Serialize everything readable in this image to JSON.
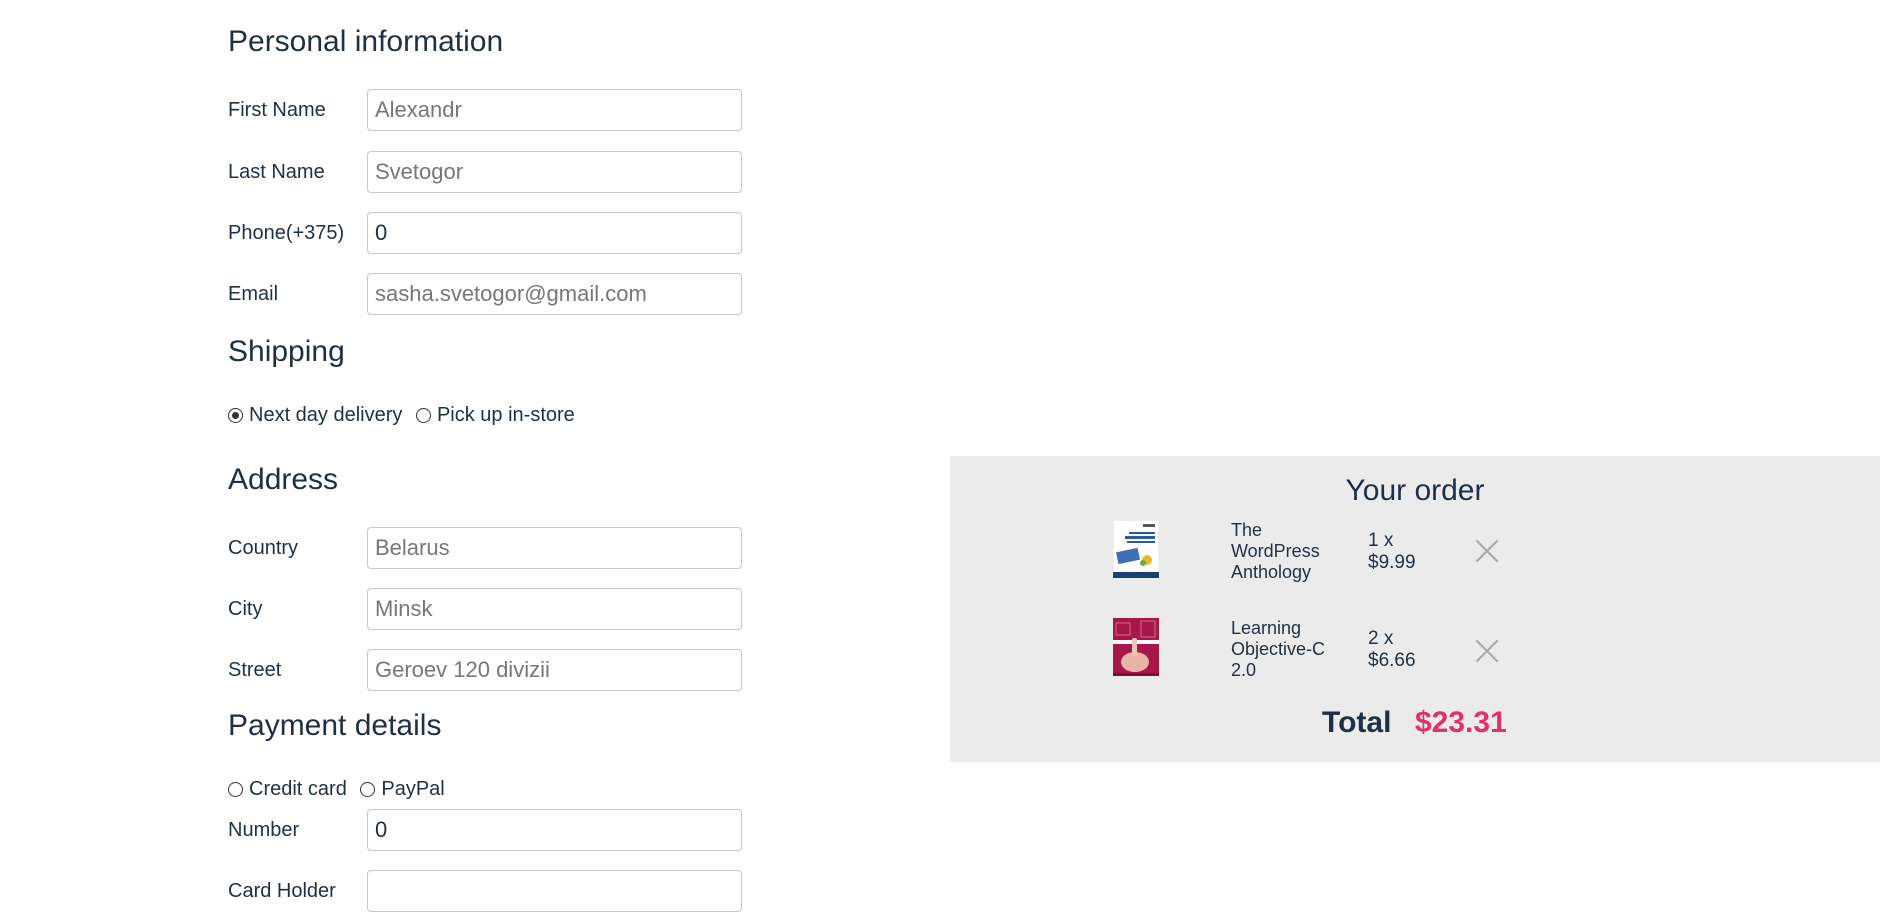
{
  "personal": {
    "heading": "Personal information",
    "first_name": {
      "label": "First Name",
      "placeholder": "Alexandr",
      "value": ""
    },
    "last_name": {
      "label": "Last Name",
      "placeholder": "Svetogor",
      "value": ""
    },
    "phone": {
      "label": "Phone(+375)",
      "placeholder": "",
      "value": "0"
    },
    "email": {
      "label": "Email",
      "placeholder": "sasha.svetogor@gmail.com",
      "value": ""
    }
  },
  "shipping": {
    "heading": "Shipping",
    "options": [
      {
        "label": "Next day delivery",
        "selected": true
      },
      {
        "label": "Pick up in-store",
        "selected": false
      }
    ]
  },
  "address": {
    "heading": "Address",
    "country": {
      "label": "Country",
      "placeholder": "Belarus",
      "value": ""
    },
    "city": {
      "label": "City",
      "placeholder": "Minsk",
      "value": ""
    },
    "street": {
      "label": "Street",
      "placeholder": "Geroev 120 divizii",
      "value": ""
    }
  },
  "payment": {
    "heading": "Payment details",
    "options": [
      {
        "label": "Credit card",
        "selected": false
      },
      {
        "label": "PayPal",
        "selected": false
      }
    ],
    "number": {
      "label": "Number",
      "placeholder": "",
      "value": "0"
    },
    "card_holder": {
      "label": "Card Holder",
      "placeholder": "",
      "value": ""
    }
  },
  "order": {
    "heading": "Your order",
    "items": [
      {
        "title": "The WordPress Anthology",
        "qty": "1 x",
        "price": "$9.99",
        "thumb_icon": "wordpress-anthology-cover"
      },
      {
        "title": "Learning Objective-C 2.0",
        "qty": "2 x",
        "price": "$6.66",
        "thumb_icon": "objective-c-cover"
      }
    ],
    "total_label": "Total",
    "total_value": "$23.31"
  },
  "colors": {
    "text": "#1f3044",
    "accent": "#e0306e",
    "panel": "#ebebeb"
  }
}
